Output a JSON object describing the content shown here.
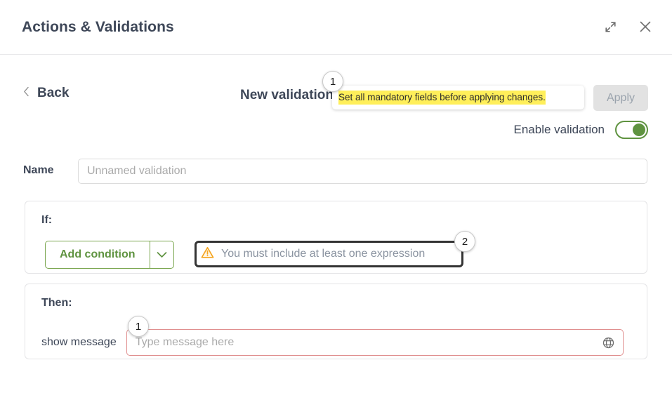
{
  "header": {
    "title": "Actions & Validations",
    "expand_icon": "expand-icon",
    "close_icon": "close-icon"
  },
  "subheader": {
    "back_label": "Back",
    "back_chevron": "chevron-left-icon",
    "subtitle": "New validation",
    "apply_label": "Apply",
    "apply_disabled": true
  },
  "enable": {
    "label": "Enable validation",
    "state": "on",
    "accent_color": "#5f9340"
  },
  "name": {
    "label": "Name",
    "value": "",
    "placeholder": "Unnamed validation"
  },
  "if_section": {
    "label": "If:",
    "add_condition_label": "Add condition",
    "caret_icon": "chevron-down-icon",
    "warning_icon": "warning-triangle-icon",
    "warning_text": "You must include at least one expression",
    "border_color": "#7aa64f"
  },
  "then_section": {
    "label": "Then:",
    "action_label": "show message",
    "message_value": "",
    "message_placeholder": "Type message here",
    "globe_icon": "globe-icon",
    "error_border_color": "#e08f8f"
  },
  "annotations": {
    "tooltip_text": "Set all mandatory fields before applying changes.",
    "tooltip_highlight_color": "#ffef5a",
    "badge_tooltip": "1",
    "badge_warning": "2",
    "badge_message": "1",
    "highlight_border_color": "#343434"
  }
}
